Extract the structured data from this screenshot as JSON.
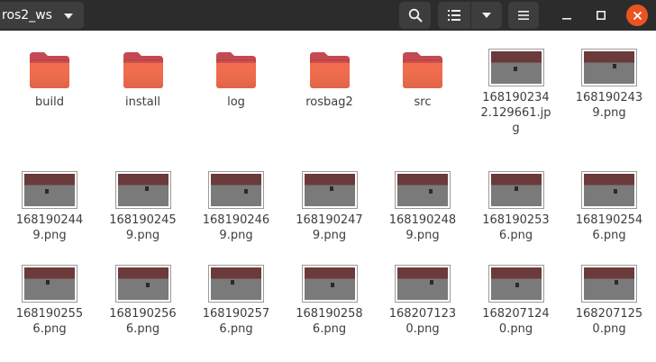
{
  "window": {
    "path_label": "ros2_ws"
  },
  "toolbar": {
    "search_icon": "search-icon",
    "view_list_icon": "list-view-icon",
    "view_options_icon": "chevron-down-icon",
    "menu_icon": "hamburger-menu-icon"
  },
  "colors": {
    "headerbar": "#2c2c2c",
    "button": "#3d3d3d",
    "close": "#e95420",
    "folder_top": "#c44a52",
    "folder_body": "#f26b4b",
    "text": "#3d3d3d"
  },
  "files": [
    {
      "name": "build",
      "kind": "folder"
    },
    {
      "name": "install",
      "kind": "folder"
    },
    {
      "name": "log",
      "kind": "folder"
    },
    {
      "name": "rosbag2",
      "kind": "folder"
    },
    {
      "name": "src",
      "kind": "folder"
    },
    {
      "name": "1681902342.129661.jpg",
      "kind": "image"
    },
    {
      "name": "1681902439.png",
      "kind": "image"
    },
    {
      "name": "1681902449.png",
      "kind": "image"
    },
    {
      "name": "1681902459.png",
      "kind": "image"
    },
    {
      "name": "1681902469.png",
      "kind": "image"
    },
    {
      "name": "1681902479.png",
      "kind": "image"
    },
    {
      "name": "1681902489.png",
      "kind": "image"
    },
    {
      "name": "1681902536.png",
      "kind": "image"
    },
    {
      "name": "1681902546.png",
      "kind": "image"
    },
    {
      "name": "1681902556.png",
      "kind": "image"
    },
    {
      "name": "1681902566.png",
      "kind": "image"
    },
    {
      "name": "1681902576.png",
      "kind": "image"
    },
    {
      "name": "1681902586.png",
      "kind": "image"
    },
    {
      "name": "1682071230.png",
      "kind": "image"
    },
    {
      "name": "1682071240.png",
      "kind": "image"
    },
    {
      "name": "1682071250.png",
      "kind": "image"
    }
  ]
}
